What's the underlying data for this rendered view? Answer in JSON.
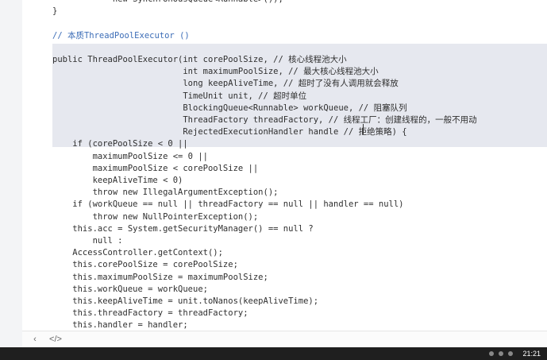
{
  "editor": {
    "lines": [
      {
        "text": "            new SynchronousQueue<Runnable>());",
        "kind": "code"
      },
      {
        "text": "}",
        "kind": "code"
      },
      {
        "text": "",
        "kind": "code"
      },
      {
        "text": "// 本质ThreadPoolExecutor ()",
        "kind": "comment-blue"
      },
      {
        "text": "",
        "kind": "code"
      },
      {
        "text": "public ThreadPoolExecutor(int corePoolSize, // 核心线程池大小",
        "kind": "code"
      },
      {
        "text": "                          int maximumPoolSize, // 最大核心线程池大小",
        "kind": "code"
      },
      {
        "text": "                          long keepAliveTime, // 超时了没有人调用就会释放",
        "kind": "code"
      },
      {
        "text": "                          TimeUnit unit, // 超时单位",
        "kind": "code"
      },
      {
        "text": "                          BlockingQueue<Runnable> workQueue, // 阻塞队列",
        "kind": "code"
      },
      {
        "text": "                          ThreadFactory threadFactory, // 线程工厂：创建线程的，一般不用动",
        "kind": "code"
      },
      {
        "text": "                          RejectedExecutionHandler handle // 拒绝策略) {",
        "kind": "code"
      },
      {
        "text": "    if (corePoolSize < 0 ||",
        "kind": "code"
      },
      {
        "text": "        maximumPoolSize <= 0 ||",
        "kind": "code"
      },
      {
        "text": "        maximumPoolSize < corePoolSize ||",
        "kind": "code"
      },
      {
        "text": "        keepAliveTime < 0)",
        "kind": "code"
      },
      {
        "text": "        throw new IllegalArgumentException();",
        "kind": "code"
      },
      {
        "text": "    if (workQueue == null || threadFactory == null || handler == null)",
        "kind": "code"
      },
      {
        "text": "        throw new NullPointerException();",
        "kind": "code"
      },
      {
        "text": "    this.acc = System.getSecurityManager() == null ?",
        "kind": "code"
      },
      {
        "text": "        null :",
        "kind": "code"
      },
      {
        "text": "    AccessController.getContext();",
        "kind": "code"
      },
      {
        "text": "    this.corePoolSize = corePoolSize;",
        "kind": "code"
      },
      {
        "text": "    this.maximumPoolSize = maximumPoolSize;",
        "kind": "code"
      },
      {
        "text": "    this.workQueue = workQueue;",
        "kind": "code"
      },
      {
        "text": "    this.keepAliveTime = unit.toNanos(keepAliveTime);",
        "kind": "code"
      },
      {
        "text": "    this.threadFactory = threadFactory;",
        "kind": "code"
      },
      {
        "text": "    this.handler = handler;",
        "kind": "code"
      }
    ]
  },
  "statusbar": {
    "back_icon": "chevron-left-icon",
    "source_icon": "code-icon"
  },
  "taskbar": {
    "time": "21:21"
  },
  "colors": {
    "selection": "#e6e8ef",
    "comment_blue": "#3c6db7"
  }
}
